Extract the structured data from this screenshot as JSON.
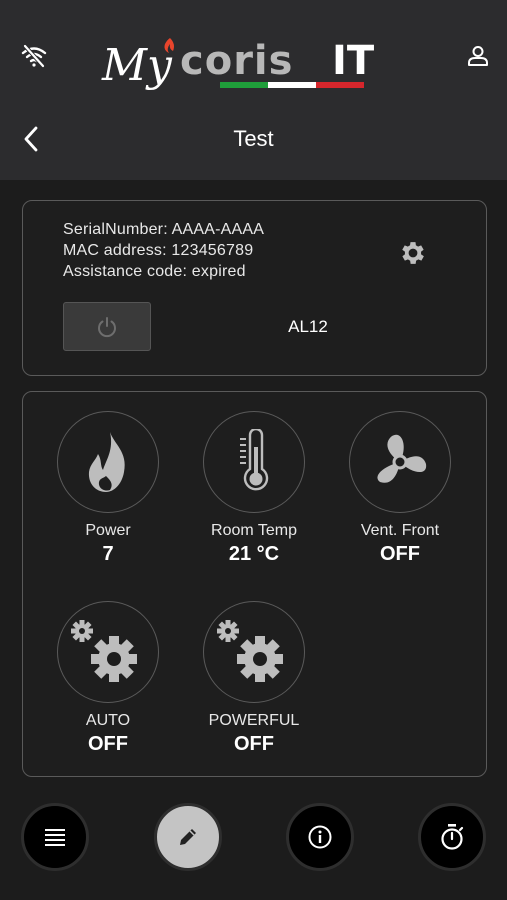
{
  "app": {
    "logo_text": "MycorisIT"
  },
  "header": {
    "title": "Test"
  },
  "device": {
    "serial_line": "SerialNumber: AAAA-AAAA",
    "mac_line": "MAC address: 123456789",
    "assistance_line": "Assistance code: expired",
    "model": "AL12"
  },
  "tiles": [
    {
      "label": "Power",
      "value": "7"
    },
    {
      "label": "Room Temp",
      "value": "21 °C"
    },
    {
      "label": "Vent. Front",
      "value": "OFF"
    },
    {
      "label": "AUTO",
      "value": "OFF"
    },
    {
      "label": "POWERFUL",
      "value": "OFF"
    }
  ],
  "colors": {
    "background": "#1c1c1c",
    "topbar": "#2c2c2e",
    "border": "#5a5a5a",
    "icon": "#bdbdbd",
    "flag_green": "#1f9e3a",
    "flag_red": "#d6262c"
  },
  "icons": {
    "top_left": "wifi-off-icon",
    "top_right": "user-icon",
    "back": "chevron-left-icon",
    "settings": "gear-icon",
    "power": "power-icon",
    "nav": [
      "list-icon",
      "pencil-icon",
      "info-icon",
      "stopwatch-icon"
    ]
  }
}
